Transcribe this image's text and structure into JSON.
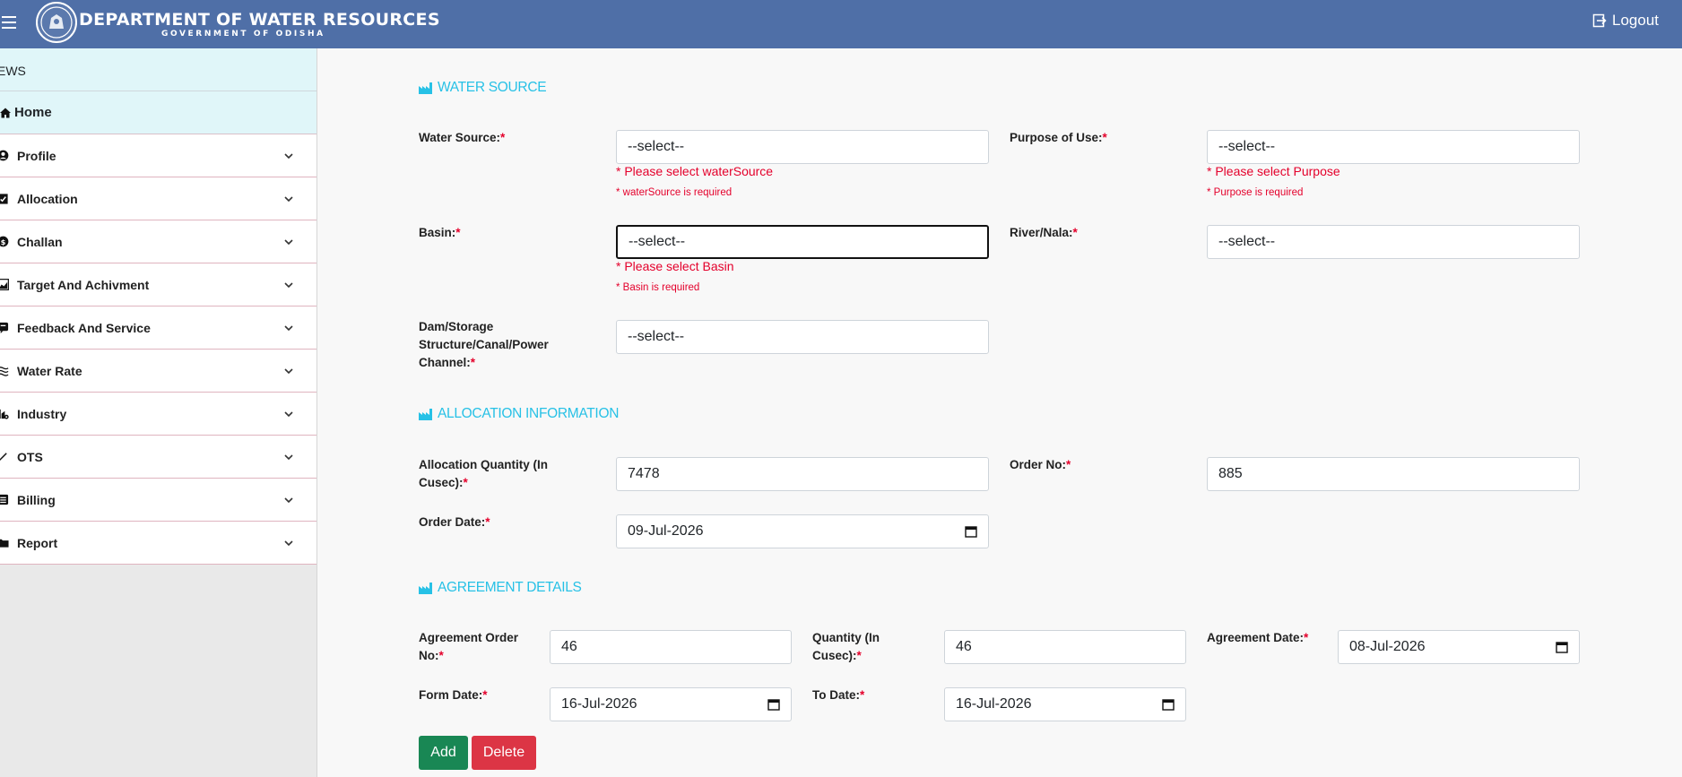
{
  "header": {
    "title": "DEPARTMENT OF WATER RESOURCES",
    "subtitle": "GOVERNMENT OF ODISHA",
    "logout_label": "Logout"
  },
  "sidebar": {
    "section": "EWS",
    "home": "Home",
    "items": [
      {
        "label": "Profile",
        "icon": "user-circle-icon"
      },
      {
        "label": "Allocation",
        "icon": "clipboard-check-icon"
      },
      {
        "label": "Challan",
        "icon": "dollar-circle-icon"
      },
      {
        "label": "Target And Achivment",
        "icon": "chart-area-icon"
      },
      {
        "label": "Feedback And Service",
        "icon": "comment-icon"
      },
      {
        "label": "Water Rate",
        "icon": "water-icon"
      },
      {
        "label": "Industry",
        "icon": "industry-icon"
      },
      {
        "label": "OTS",
        "icon": "pencil-icon"
      },
      {
        "label": "Billing",
        "icon": "list-icon"
      },
      {
        "label": "Report",
        "icon": "folder-icon"
      }
    ]
  },
  "water_source": {
    "title": "WATER SOURCE",
    "water_source_label": "Water Source:",
    "water_source_value": "--select--",
    "water_source_err1": "* Please select waterSource",
    "water_source_err2": "* waterSource is required",
    "purpose_label": "Purpose of Use:",
    "purpose_value": "--select--",
    "purpose_err1": "* Please select Purpose",
    "purpose_err2": "* Purpose is required",
    "basin_label": "Basin:",
    "basin_value": "--select--",
    "basin_err1": "* Please select Basin",
    "basin_err2": "* Basin is required",
    "river_label": "River/Nala:",
    "river_value": "--select--",
    "dam_label_1": "Dam/Storage",
    "dam_label_2": "Structure/Canal/Power",
    "dam_label_3": "Channel:",
    "dam_value": "--select--"
  },
  "allocation": {
    "title": "ALLOCATION INFORMATION",
    "qty_label_1": "Allocation Quantity (In",
    "qty_label_2": "Cusec):",
    "qty_value": "7478",
    "order_no_label": "Order No:",
    "order_no_value": "885",
    "order_date_label": "Order Date:",
    "order_date_value": "09-Jul-2026"
  },
  "agreement": {
    "title": "AGREEMENT DETAILS",
    "order_no_label_1": "Agreement Order",
    "order_no_label_2": "No:",
    "order_no_value": "46",
    "qty_label_1": "Quantity (In",
    "qty_label_2": "Cusec):",
    "qty_value": "46",
    "date_label": "Agreement Date:",
    "date_value": "08-Jul-2026",
    "form_date_label": "Form Date:",
    "form_date_value": "16-Jul-2026",
    "to_date_label": "To Date:",
    "to_date_value": "16-Jul-2026",
    "add_label": "Add",
    "delete_label": "Delete"
  },
  "required_mark": "*",
  "colors": {
    "header": "#4f6fa7",
    "accent": "#27c1e6",
    "error": "#e4002b",
    "add": "#198754",
    "delete": "#dc3545"
  }
}
